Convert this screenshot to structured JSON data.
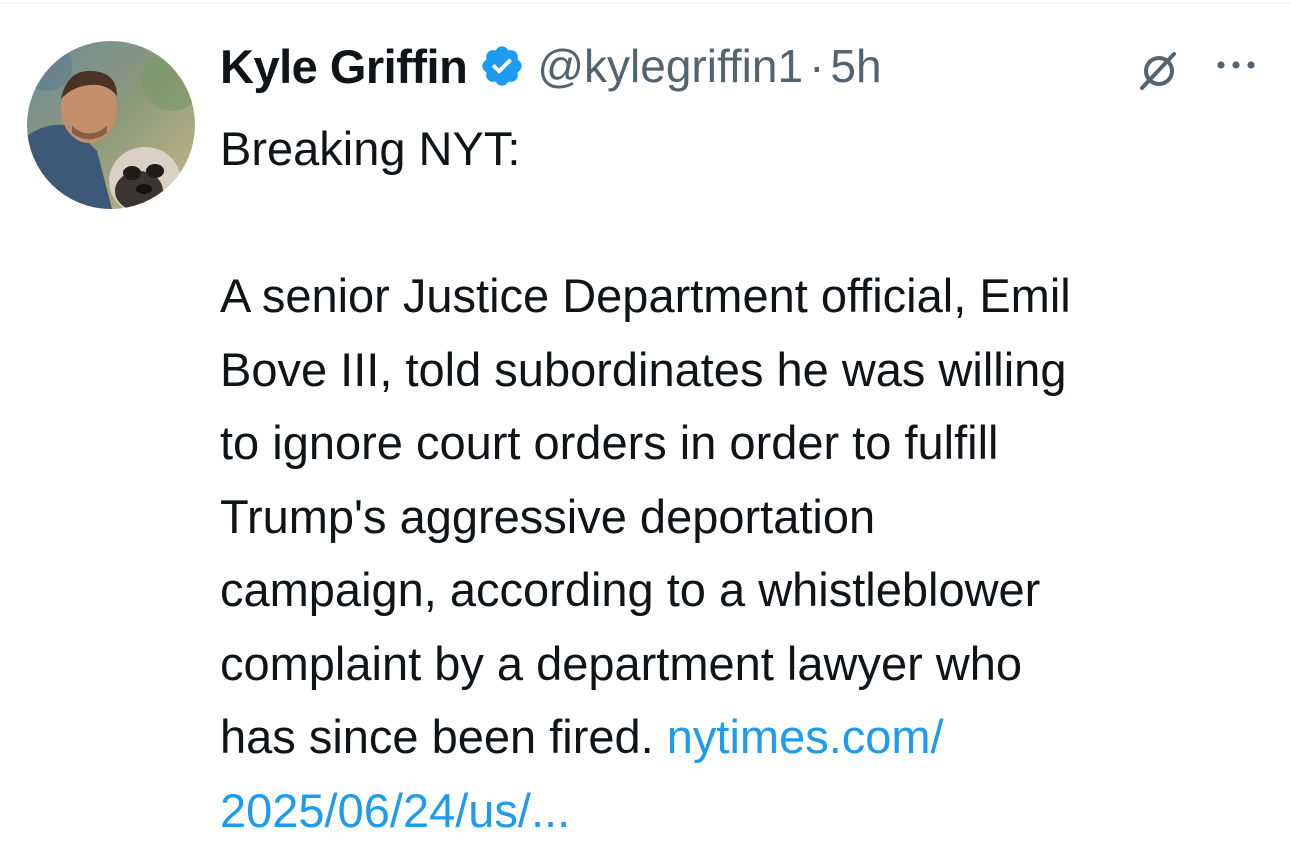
{
  "tweet": {
    "author": {
      "display_name": "Kyle Griffin",
      "handle": "@kylegriffin1",
      "verified": true,
      "avatar_icon": "user-avatar-photo"
    },
    "separator": "·",
    "timestamp": "5h",
    "text_lines": [
      "Breaking NYT:",
      "",
      "A senior Justice Department official, Emil",
      "Bove III, told subordinates he was willing",
      "to ignore court orders in order to fulfill",
      "Trump's aggressive deportation",
      "campaign, according to a whistleblower",
      "complaint by a department lawyer who",
      "has since been fired. "
    ],
    "link": {
      "line1": "nytimes.com/",
      "line2": "2025/06/24/us/..."
    }
  },
  "icons": {
    "verified": "verified-badge-icon",
    "grok": "grok-icon",
    "more": "more-options-icon"
  },
  "colors": {
    "text": "#0f1419",
    "secondary": "#536471",
    "link": "#1d9bf0",
    "verified": "#1d9bf0"
  }
}
